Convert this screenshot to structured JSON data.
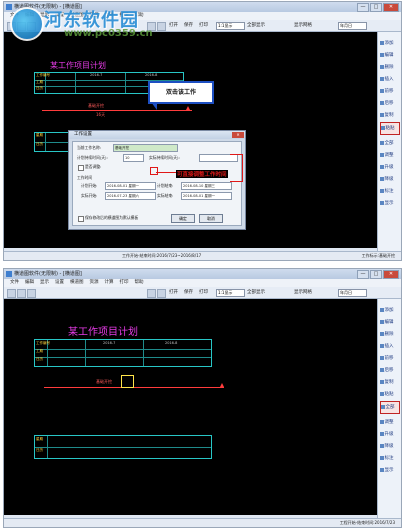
{
  "watermark": {
    "site_name": "河东软件园",
    "url": "www.pc0359.cn"
  },
  "window": {
    "title": "横道图软件(无限制) - [横道图]",
    "minimize": "—",
    "maximize": "□",
    "close": "✕"
  },
  "menu": [
    "文件",
    "编辑",
    "显示",
    "设置",
    "横道图",
    "资源",
    "计算",
    "打印",
    "帮助"
  ],
  "toolbar": {
    "open_label": "打开",
    "save_label": "保存",
    "print_label": "打印",
    "zoom_select": "1:1显示",
    "show_all_label": "全部显示",
    "show_grid_label": "显示网格",
    "unit_select": "年月日"
  },
  "right_panel": {
    "items": [
      "添加",
      "编辑",
      "删除",
      "插入",
      "前移",
      "后移",
      "复制",
      "粘贴",
      "全部",
      "调整",
      "升级",
      "降级",
      "标注",
      "显示"
    ],
    "selected_index_top": 8,
    "selected_index_bottom": 8
  },
  "chart": {
    "title": "某工作项目计划",
    "columns_top": [
      "工作编号",
      "2016-7",
      "",
      "2016-8",
      ""
    ],
    "rows_top": [
      "工期",
      "日历"
    ],
    "rows_bottom": [
      "星期",
      "日历"
    ],
    "task_name": "基础开挖",
    "task_days": "16天"
  },
  "callout": {
    "text": "双击该工作"
  },
  "dialog": {
    "title": "工作设置",
    "close": "✕",
    "name_label": "当前工作名称:",
    "name_value": "基础开挖",
    "duration_label": "计划持续时间(天):",
    "duration_value": "10",
    "real_duration_label": "实际持续时间(天):",
    "real_duration_value": "",
    "progress_label": "是否调整:",
    "work_time_label": "工作时间",
    "plan_start_label": "计划开始:",
    "plan_start_value": "2016-08-01 星期一",
    "plan_end_label": "计划结束:",
    "plan_end_value": "2016-08-10 星期三",
    "actual_start_label": "实际开始:",
    "actual_start_value": "2016-07-23 星期六",
    "actual_end_label": "实际结束:",
    "actual_end_value": "2016-08-01 星期一",
    "keep_label": "保存修改后的横道图为默认模板",
    "ok_label": "确定",
    "cancel_label": "取消"
  },
  "annotation": {
    "text": "可直接调整工作时间"
  },
  "status": {
    "left_top": "工作开始-结束时间:2016/7/23~2016/8/17",
    "right_top": "工作标示:基础开挖",
    "left_bottom": "",
    "right_bottom": "工程开始-结束时间:2016/7/23"
  }
}
